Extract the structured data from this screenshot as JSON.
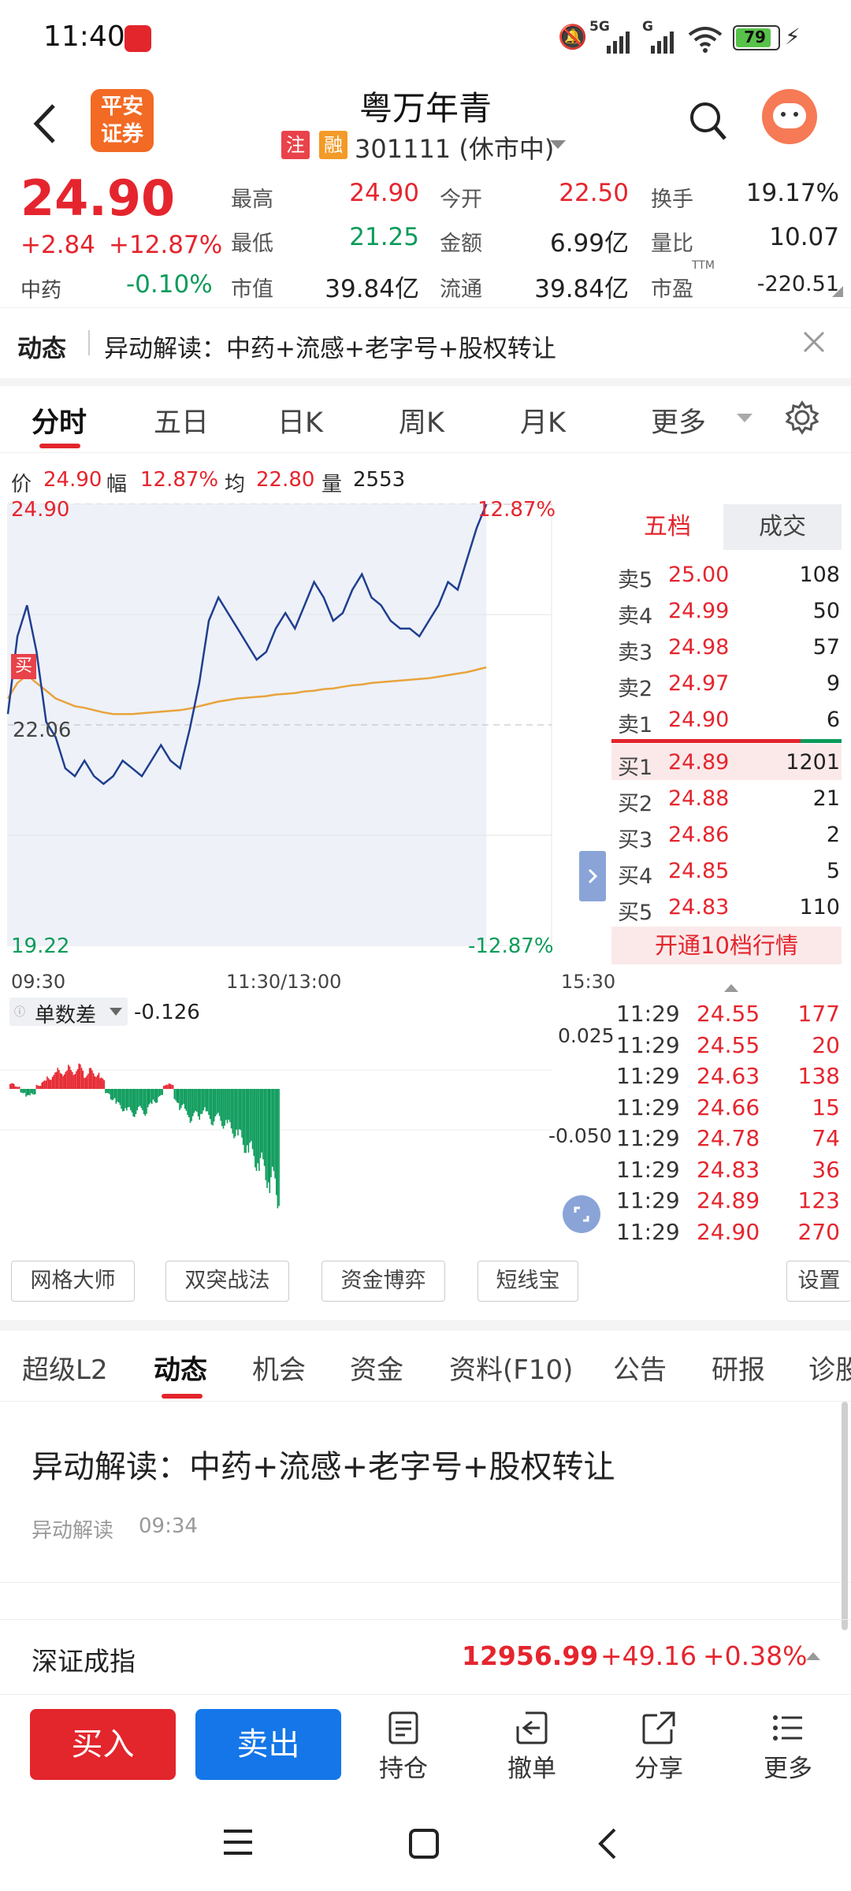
{
  "status": {
    "time": "11:40",
    "battery": "79",
    "net1": "5G",
    "net2": "G"
  },
  "header": {
    "back_label": "‹",
    "logo_line1": "平安",
    "logo_line2": "证券",
    "title": "粤万年青",
    "badge1": "注",
    "badge2": "融",
    "subtitle": "301111 (休市中)"
  },
  "quote": {
    "price": "24.90",
    "change": "+2.84",
    "change_pct": "+12.87%",
    "sector": "中药",
    "sector_pct": "-0.10%",
    "grid": [
      {
        "label": "最高",
        "value": "24.90",
        "color": "red"
      },
      {
        "label": "今开",
        "value": "22.50",
        "color": "red"
      },
      {
        "label": "换手",
        "value": "19.17%",
        "color": "black"
      },
      {
        "label": "最低",
        "value": "21.25",
        "color": "green"
      },
      {
        "label": "金额",
        "value": "6.99亿",
        "color": "black"
      },
      {
        "label": "量比",
        "value": "10.07",
        "color": "black"
      },
      {
        "label": "市值",
        "value": "39.84亿",
        "color": "black"
      },
      {
        "label": "流通",
        "value": "39.84亿",
        "color": "black"
      },
      {
        "label": "市盈",
        "value": "-220.51",
        "color": "black"
      }
    ],
    "ttm_label": "TTM"
  },
  "news": {
    "tag": "动态",
    "text": "异动解读：中药+流感+老字号+股权转让"
  },
  "tabs": [
    "分时",
    "五日",
    "日K",
    "周K",
    "月K",
    "更多"
  ],
  "info": {
    "price_label": "价",
    "price": "24.90",
    "amp_label": "幅",
    "amp": "12.87%",
    "avg_label": "均",
    "avg": "22.80",
    "vol_label": "量",
    "vol": "2553"
  },
  "chart_data": {
    "type": "line",
    "title": "",
    "y_top_label": "24.90",
    "y_mid_label": "22.06",
    "y_bottom_label": "19.22",
    "pct_top_label": "12.87%",
    "pct_bottom_label": "-12.87%",
    "x_labels": [
      "09:30",
      "11:30/13:00",
      "15:30"
    ],
    "ylim": [
      19.22,
      24.9
    ],
    "prev_close": 22.06,
    "buy_marker": "买",
    "price_series": [
      22.2,
      23.2,
      23.6,
      23.0,
      22.1,
      21.9,
      21.5,
      21.4,
      21.6,
      21.4,
      21.3,
      21.4,
      21.6,
      21.5,
      21.4,
      21.6,
      21.8,
      21.6,
      21.5,
      22.0,
      22.6,
      23.4,
      23.7,
      23.5,
      23.3,
      23.1,
      22.9,
      23.0,
      23.3,
      23.5,
      23.3,
      23.6,
      23.9,
      23.7,
      23.4,
      23.5,
      23.8,
      24.0,
      23.7,
      23.6,
      23.4,
      23.3,
      23.3,
      23.2,
      23.4,
      23.6,
      23.9,
      23.8,
      24.2,
      24.6,
      24.9
    ],
    "avg_series": [
      22.4,
      22.6,
      22.7,
      22.6,
      22.5,
      22.4,
      22.35,
      22.3,
      22.28,
      22.25,
      22.22,
      22.2,
      22.2,
      22.2,
      22.21,
      22.22,
      22.23,
      22.24,
      22.25,
      22.27,
      22.3,
      22.33,
      22.36,
      22.38,
      22.4,
      22.41,
      22.42,
      22.43,
      22.45,
      22.46,
      22.47,
      22.49,
      22.5,
      22.52,
      22.53,
      22.55,
      22.57,
      22.58,
      22.6,
      22.61,
      22.62,
      22.63,
      22.64,
      22.65,
      22.66,
      22.68,
      22.7,
      22.72,
      22.74,
      22.77,
      22.8
    ]
  },
  "indicator": {
    "name": "单数差",
    "value": "-0.126",
    "top_label": "0.025",
    "mid_label": "-0.050",
    "bars": [
      0.004,
      0.002,
      -0.003,
      -0.006,
      -0.004,
      0.003,
      0.006,
      0.009,
      0.012,
      0.015,
      0.013,
      0.017,
      0.014,
      0.018,
      0.011,
      0.015,
      0.012,
      0.008,
      -0.004,
      -0.008,
      -0.013,
      -0.016,
      -0.018,
      -0.02,
      -0.017,
      -0.019,
      -0.014,
      -0.01,
      -0.006,
      0.003,
      0.004,
      -0.01,
      -0.015,
      -0.02,
      -0.024,
      -0.022,
      -0.018,
      -0.022,
      -0.026,
      -0.024,
      -0.028,
      -0.031,
      -0.035,
      -0.04,
      -0.046,
      -0.052,
      -0.058,
      -0.064,
      -0.07,
      -0.078,
      -0.085
    ]
  },
  "orderbook": {
    "tab_active": "五档",
    "tab_other": "成交",
    "sells": [
      {
        "label": "卖5",
        "price": "25.00",
        "vol": "108"
      },
      {
        "label": "卖4",
        "price": "24.99",
        "vol": "50"
      },
      {
        "label": "卖3",
        "price": "24.98",
        "vol": "57"
      },
      {
        "label": "卖2",
        "price": "24.97",
        "vol": "9"
      },
      {
        "label": "卖1",
        "price": "24.90",
        "vol": "6"
      }
    ],
    "buys": [
      {
        "label": "买1",
        "price": "24.89",
        "vol": "1201"
      },
      {
        "label": "买2",
        "price": "24.88",
        "vol": "21"
      },
      {
        "label": "买3",
        "price": "24.86",
        "vol": "2"
      },
      {
        "label": "买4",
        "price": "24.85",
        "vol": "5"
      },
      {
        "label": "买5",
        "price": "24.83",
        "vol": "110"
      }
    ],
    "upgrade": "开通10档行情"
  },
  "trades": [
    {
      "time": "11:29",
      "price": "24.55",
      "vol": "177"
    },
    {
      "time": "11:29",
      "price": "24.55",
      "vol": "20"
    },
    {
      "time": "11:29",
      "price": "24.63",
      "vol": "138"
    },
    {
      "time": "11:29",
      "price": "24.66",
      "vol": "15"
    },
    {
      "time": "11:29",
      "price": "24.78",
      "vol": "74"
    },
    {
      "time": "11:29",
      "price": "24.83",
      "vol": "36"
    },
    {
      "time": "11:29",
      "price": "24.89",
      "vol": "123"
    },
    {
      "time": "11:29",
      "price": "24.90",
      "vol": "270"
    }
  ],
  "tools": [
    "网格大师",
    "双突战法",
    "资金博弈",
    "短线宝",
    "设置"
  ],
  "subtabs": [
    "超级L2",
    "动态",
    "机会",
    "资金",
    "资料(F10)",
    "公告",
    "研报",
    "诊股"
  ],
  "article": {
    "title": "异动解读：中药+流感+老字号+股权转让",
    "source": "异动解读",
    "time": "09:34"
  },
  "index_bar": {
    "name": "深证成指",
    "value": "12956.99",
    "change": "+49.16",
    "pct": "+0.38%"
  },
  "actions": {
    "buy": "买入",
    "sell": "卖出",
    "hold": "持仓",
    "cancel": "撤单",
    "share": "分享",
    "more": "更多"
  },
  "colors": {
    "up": "#e5252e",
    "down": "#0b9b5a",
    "buy_btn": "#e3252c",
    "sell_btn": "#1476e8",
    "price_line": "#1f3f8f",
    "avg_line": "#e9a33c"
  }
}
